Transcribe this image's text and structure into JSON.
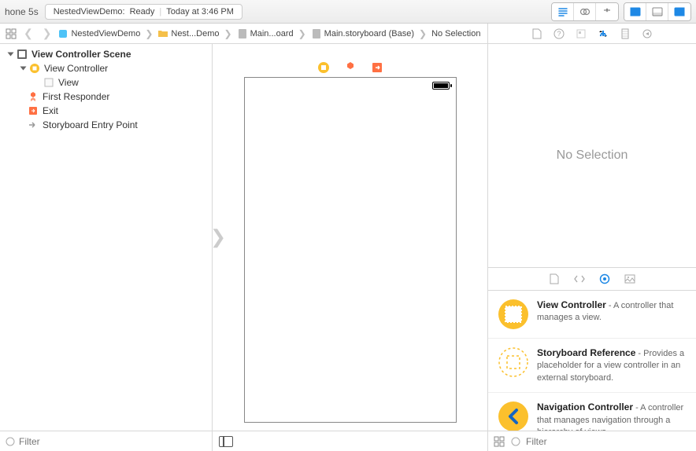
{
  "toolbar": {
    "device": "hone 5s",
    "status_project": "NestedViewDemo:",
    "status_state": "Ready",
    "status_time": "Today at 3:46 PM"
  },
  "jumpbar": {
    "crumbs": [
      {
        "label": "NestedViewDemo",
        "icon": "blue"
      },
      {
        "label": "Nest...Demo",
        "icon": "folder"
      },
      {
        "label": "Main...oard",
        "icon": "gray"
      },
      {
        "label": "Main.storyboard (Base)",
        "icon": "gray"
      },
      {
        "label": "No Selection",
        "icon": "none"
      }
    ]
  },
  "outline": {
    "scene_title": "View Controller Scene",
    "items": {
      "vc": "View Controller",
      "view": "View",
      "first_responder": "First Responder",
      "exit": "Exit",
      "entry": "Storyboard Entry Point"
    },
    "filter_placeholder": "Filter"
  },
  "inspector": {
    "empty": "No Selection",
    "filter_placeholder": "Filter"
  },
  "library": [
    {
      "title": "View Controller",
      "desc": " - A controller that manages a view.",
      "icon": "vc"
    },
    {
      "title": "Storyboard Reference",
      "desc": " - Provides a placeholder for a view controller in an external storyboard.",
      "icon": "sbref"
    },
    {
      "title": "Navigation Controller",
      "desc": " - A controller that manages navigation through a hierarchy of views.",
      "icon": "nav"
    }
  ]
}
